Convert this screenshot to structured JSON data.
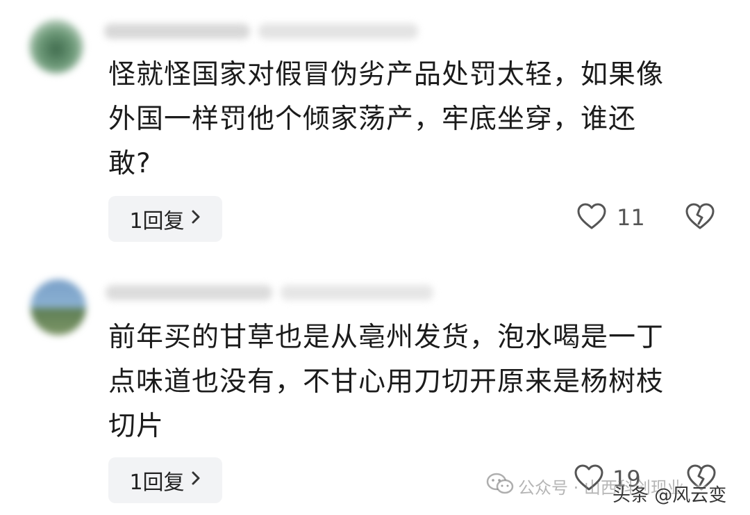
{
  "comments": [
    {
      "text": "怪就怪国家对假冒伪劣产品处罚太轻，如果像\n外国一样罚他个倾家荡产，牢底坐穿，谁还\n敢?",
      "reply_label": "1回复",
      "like_count": "11"
    },
    {
      "text": "前年买的甘草也是从亳州发货，泡水喝是一丁\n点味道也没有，不甘心用刀切开原来是杨树枝\n切片",
      "reply_label": "1回复",
      "like_count": "19"
    }
  ],
  "watermark": {
    "wechat": "公众号 · 山西科创现业",
    "toutiao": "头条 @风云变"
  },
  "icons": {
    "like": "heart-icon",
    "dislike": "broken-heart-icon",
    "chevron": "chevron-right-icon",
    "wechat": "wechat-logo"
  },
  "colors": {
    "text": "#1b1b1b",
    "reply_bg": "#f2f3f5",
    "icon": "#555555"
  }
}
